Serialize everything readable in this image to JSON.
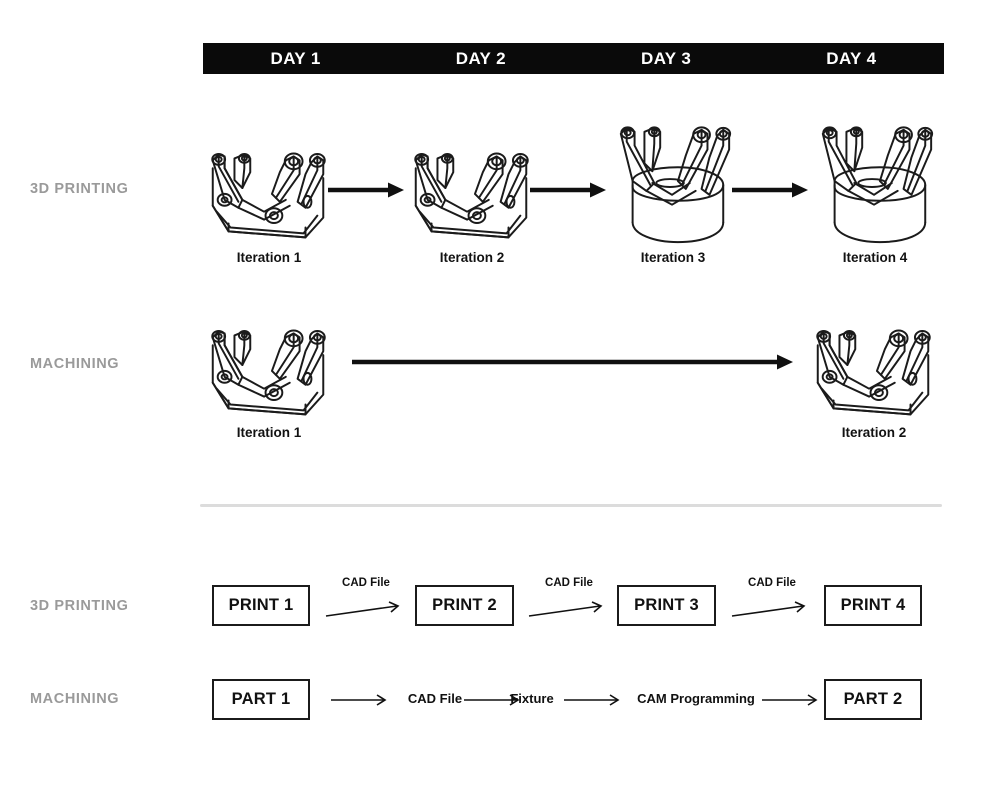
{
  "header": {
    "days": [
      "DAY 1",
      "DAY 2",
      "DAY 3",
      "DAY 4"
    ]
  },
  "rows": {
    "printing_top_label": "3D PRINTING",
    "machining_top_label": "MACHINING",
    "printing_bottom_label": "3D PRINTING",
    "machining_bottom_label": "MACHINING"
  },
  "printing_iterations": [
    {
      "caption": "Iteration 1"
    },
    {
      "caption": "Iteration 2"
    },
    {
      "caption": "Iteration 3"
    },
    {
      "caption": "Iteration 4"
    }
  ],
  "machining_iterations": [
    {
      "caption": "Iteration 1"
    },
    {
      "caption": "Iteration 2"
    }
  ],
  "printing_flow": {
    "boxes": [
      "PRINT 1",
      "PRINT 2",
      "PRINT 3",
      "PRINT 4"
    ],
    "connectors": [
      "CAD File",
      "CAD File",
      "CAD File"
    ]
  },
  "machining_flow": {
    "start_box": "PART 1",
    "end_box": "PART 2",
    "steps": [
      "CAD File",
      "Fixture",
      "CAM Programming"
    ]
  },
  "colors": {
    "header_bar": "#0a0a0a",
    "header_text": "#ffffff",
    "row_label": "#9a9a9a",
    "ink": "#111111",
    "divider": "#dcdcdc",
    "page_background": "#ffffff"
  },
  "icons": {
    "part": "bracket-yoke-icon",
    "part_with_base": "bracket-yoke-cylinder-base-icon",
    "arrow": "arrow-right-icon"
  }
}
